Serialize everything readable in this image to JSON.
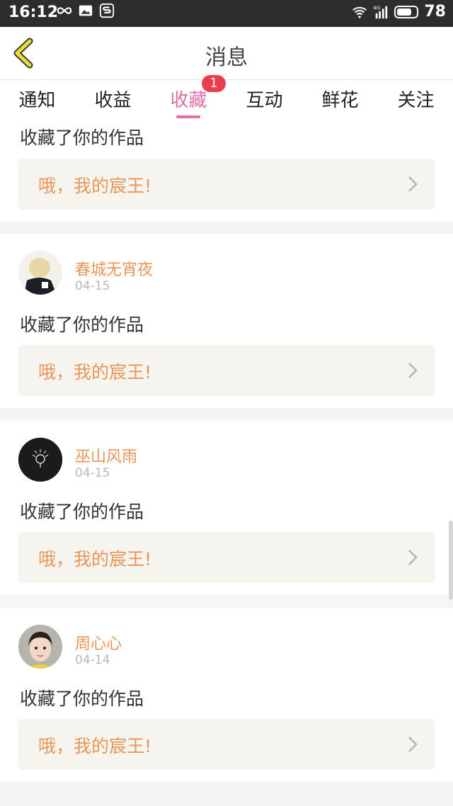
{
  "status_bar": {
    "time": "16:12",
    "network": "4G",
    "battery": "78"
  },
  "header": {
    "title": "消息"
  },
  "tabs": [
    {
      "label": "通知"
    },
    {
      "label": "收益"
    },
    {
      "label": "收藏",
      "active": true,
      "badge": "1"
    },
    {
      "label": "互动"
    },
    {
      "label": "鲜花"
    },
    {
      "label": "关注"
    }
  ],
  "messages": [
    {
      "action": "收藏了你的作品",
      "work_title": "哦，我的宸王!"
    },
    {
      "user": "春城无宵夜",
      "date": "04-15",
      "action": "收藏了你的作品",
      "work_title": "哦，我的宸王!"
    },
    {
      "user": "巫山风雨",
      "date": "04-15",
      "action": "收藏了你的作品",
      "work_title": "哦，我的宸王!"
    },
    {
      "user": "周心心",
      "date": "04-14",
      "action": "收藏了你的作品",
      "work_title": "哦，我的宸王!"
    }
  ],
  "colors": {
    "accent_pink": "#e06fa8",
    "username_orange": "#e8955a",
    "badge_red": "#ec3d4c"
  }
}
